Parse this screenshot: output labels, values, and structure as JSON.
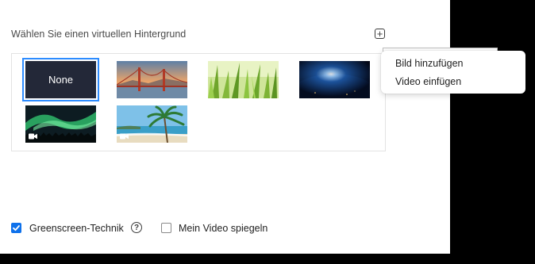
{
  "section": {
    "title": "Wählen Sie einen virtuellen Hintergrund"
  },
  "add_button": {
    "icon": "plus-icon",
    "symbol": "+"
  },
  "menu": {
    "items": [
      {
        "label": "Bild hinzufügen"
      },
      {
        "label": "Video einfügen"
      }
    ]
  },
  "backgrounds": [
    {
      "label": "None",
      "selected": true,
      "type": "none"
    },
    {
      "label": "",
      "type": "image",
      "subject": "golden-gate-bridge"
    },
    {
      "label": "",
      "type": "image",
      "subject": "green-grass"
    },
    {
      "label": "",
      "type": "image",
      "subject": "earth-from-space"
    },
    {
      "label": "",
      "type": "video",
      "subject": "aurora"
    },
    {
      "label": "",
      "type": "video",
      "subject": "beach-palm"
    }
  ],
  "options": {
    "greenscreen": {
      "label": "Greenscreen-Technik",
      "checked": true,
      "help_icon": "question-circle-icon",
      "help_symbol": "?"
    },
    "mirror": {
      "label": "Mein Video spiegeln",
      "checked": false
    }
  },
  "colors": {
    "accent": "#0e71eb",
    "selected_outline": "#2d8cff",
    "none_tile": "#232838"
  }
}
